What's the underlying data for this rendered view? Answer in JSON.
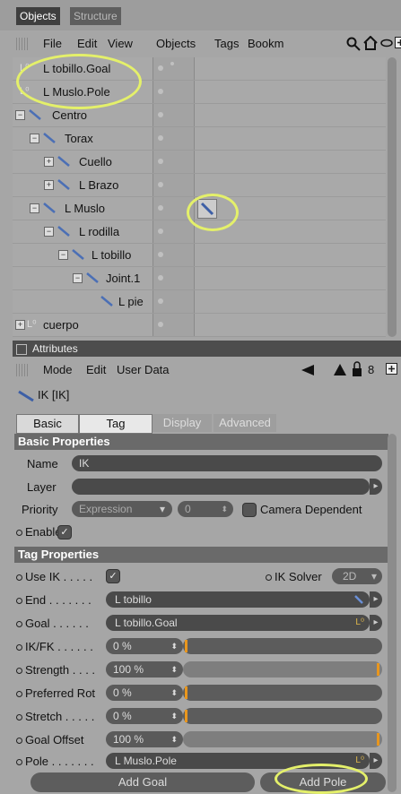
{
  "tabs": [
    {
      "label": "Objects"
    },
    {
      "label": "Structure"
    }
  ],
  "menu": [
    "File",
    "Edit",
    "View",
    "Objects",
    "Tags",
    "Bookm"
  ],
  "tree": [
    {
      "label": "L tobillo.Goal"
    },
    {
      "label": "L Muslo.Pole"
    },
    {
      "label": "Centro"
    },
    {
      "label": "Torax"
    },
    {
      "label": "Cuello"
    },
    {
      "label": "L Brazo"
    },
    {
      "label": "L Muslo"
    },
    {
      "label": "L rodilla"
    },
    {
      "label": "L tobillo"
    },
    {
      "label": "Joint.1"
    },
    {
      "label": "L pie"
    },
    {
      "label": "cuerpo"
    }
  ],
  "attributes": {
    "title": "Attributes",
    "menu": [
      "Mode",
      "Edit",
      "User Data"
    ],
    "object_label": "IK [IK]",
    "subtabs": [
      "Basic",
      "Tag",
      "Display",
      "Advanced"
    ],
    "basic_header": "Basic Properties",
    "name_label": "Name",
    "name_value": "IK",
    "layer_label": "Layer",
    "priority_label": "Priority",
    "priority_mode": "Expression",
    "priority_value": "0",
    "camera_dep": "Camera Dependent",
    "enable_label": "Enable",
    "tag_header": "Tag Properties",
    "use_ik": "Use IK . . . . .",
    "ik_solver_label": "IK Solver",
    "ik_solver_value": "2D",
    "end_label": "End . . . . . . .",
    "end_value": "L tobillo",
    "goal_label": "Goal . . . . . .",
    "goal_value": "L tobillo.Goal",
    "ikfk_label": "IK/FK . . . . . .",
    "ikfk_value": "0 %",
    "strength_label": "Strength . . . .",
    "strength_value": "100 %",
    "pref_label": "Preferred Rot",
    "pref_value": "0 %",
    "stretch_label": "Stretch . . . . .",
    "stretch_value": "0 %",
    "goaloff_label": "Goal Offset",
    "goaloff_value": "100 %",
    "pole_label": "Pole . . . . . . .",
    "pole_value": "L Muslo.Pole",
    "add_goal": "Add Goal",
    "add_pole": "Add Pole"
  },
  "colors": {
    "highlight": "#e4f06a",
    "slider_mark": "#e8961e"
  }
}
